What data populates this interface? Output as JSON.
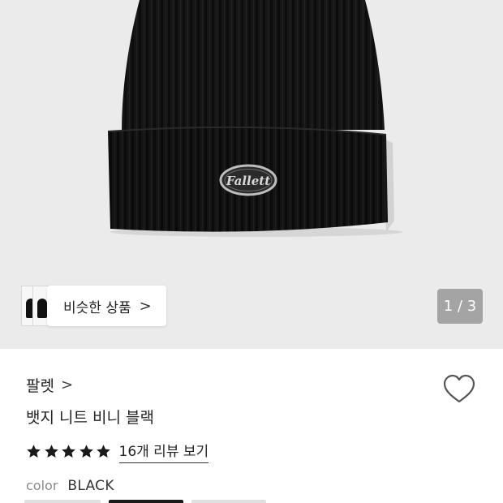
{
  "hero": {
    "logo_text": "Fallett",
    "similar_label": "비슷한 상품",
    "similar_chevron": ">",
    "page_indicator": "1 / 3",
    "colors": {
      "background": "#ebebeb",
      "beanie": "#151515"
    }
  },
  "product": {
    "brand": "팔렛",
    "brand_chevron": ">",
    "title": "뱃지 니트 비니 블랙",
    "rating_stars": 5,
    "review_link": "16개 리뷰 보기",
    "color_label": "color",
    "color_value": "BLACK"
  },
  "icons": {
    "heart": "heart-outline-icon",
    "star": "star-filled-icon",
    "chevron": "chevron-right-icon"
  },
  "colors": {
    "text": "#222222",
    "muted": "#888888",
    "pager_bg": "#a4a4a4"
  }
}
